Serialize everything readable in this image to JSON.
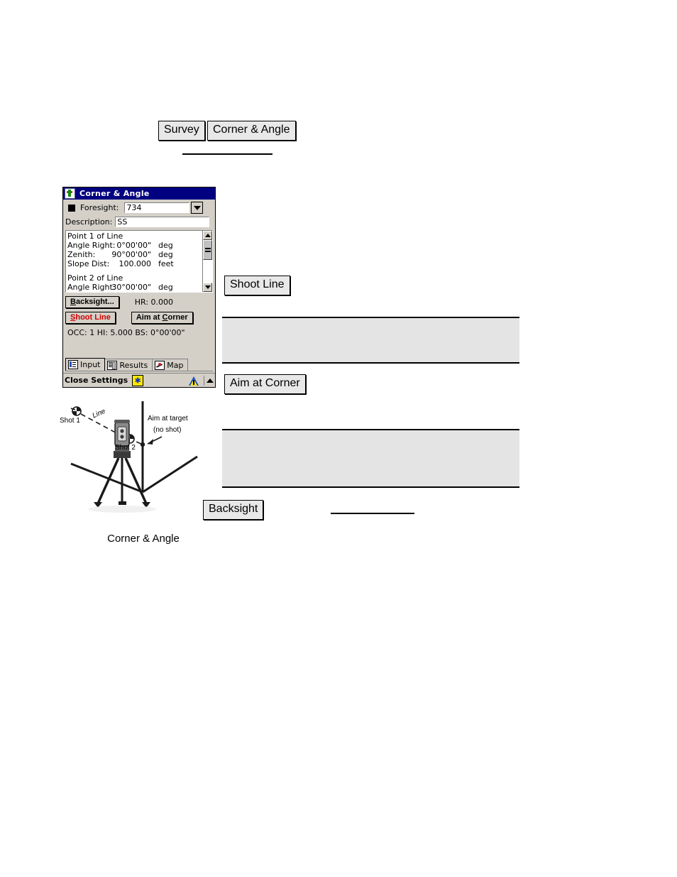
{
  "breadcrumb": {
    "items": [
      "Survey",
      "Corner & Angle"
    ]
  },
  "window": {
    "title": "Corner & Angle",
    "title_icon": "app-icon",
    "foresight": {
      "label": "Foresight:",
      "value": "734",
      "dropdown_icon": "chevron-down-icon",
      "option_marker": "square-bullet-icon"
    },
    "description": {
      "label": "Description:",
      "value": "SS"
    },
    "list": [
      {
        "label": "Point 1 of Line",
        "value": "",
        "unit": ""
      },
      {
        "label": "Angle Right:",
        "value": "0°00'00\"",
        "unit": "deg"
      },
      {
        "label": "Zenith:",
        "value": "90°00'00\"",
        "unit": "deg"
      },
      {
        "label": "Slope Dist:",
        "value": "100.000",
        "unit": "feet"
      },
      {
        "label": "",
        "value": "",
        "unit": ""
      },
      {
        "label": "Point 2 of Line",
        "value": "",
        "unit": ""
      },
      {
        "label": "Angle Right:",
        "value": "30°00'00\"",
        "unit": "deg"
      }
    ],
    "scrollbar": {
      "up_icon": "scroll-up-arrow-icon",
      "down_icon": "scroll-down-arrow-icon",
      "thumb_icon": "scroll-thumb-grip"
    },
    "buttons": {
      "backsight": "Backsight...",
      "backsight_accesskey": "B",
      "shoot_line": "Shoot Line",
      "shoot_line_accesskey": "S",
      "aim_at_corner": "Aim at Corner",
      "aim_at_corner_accesskey": "C"
    },
    "readouts": {
      "hr": "HR: 0.000",
      "occ_line": "OCC: 1  HI: 5.000  BS: 0°00'00\""
    },
    "tabs": [
      {
        "label": "Input",
        "icon": "input-form-icon",
        "active": true
      },
      {
        "label": "Results",
        "icon": "results-list-icon",
        "active": false
      },
      {
        "label": "Map",
        "icon": "map-icon",
        "active": false
      }
    ],
    "statusbar": {
      "close_label": "Close",
      "settings_label": "Settings",
      "combined_label": "Close Settings",
      "star_icon": "yellow-star-icon",
      "warning_icon": "warning-triangle-icon",
      "up_arrow_icon": "scroll-up-arrow-icon"
    },
    "colors": {
      "titlebar": "#000080",
      "window_face": "#d4d0c8",
      "shoot_line_text": "#d00000",
      "star_background": "#ffe800"
    }
  },
  "callouts": {
    "shoot_line": "Shoot Line",
    "aim_at_corner": "Aim at Corner",
    "backsight": "Backsight"
  },
  "diagram": {
    "caption": "Corner & Angle",
    "labels": {
      "shot1": "Shot 1",
      "line": "Line",
      "shot2": "Shot 2",
      "aim_target": "Aim at target",
      "no_shot": "(no shot)"
    }
  }
}
